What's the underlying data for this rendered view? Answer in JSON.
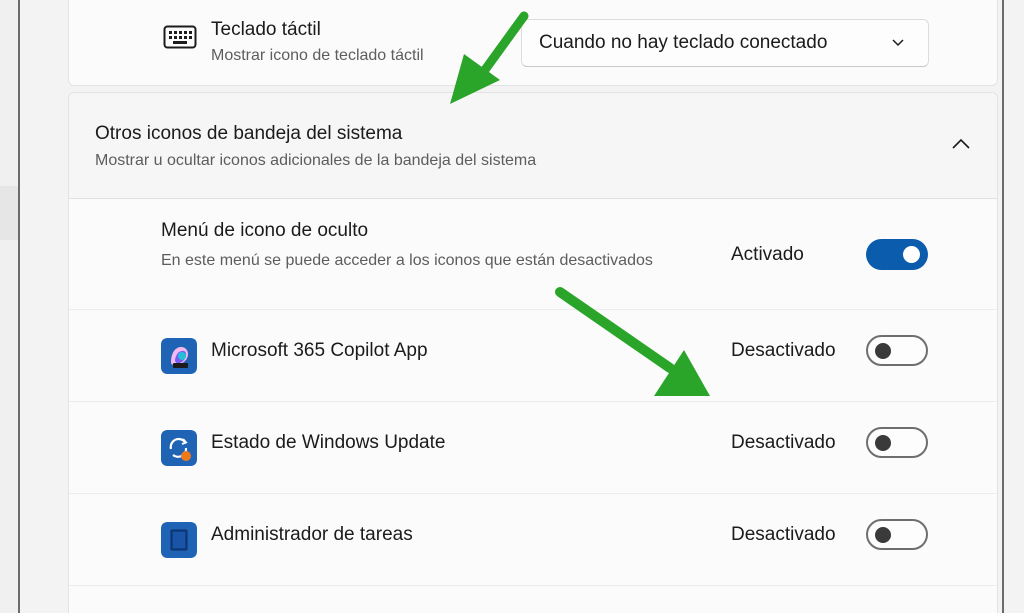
{
  "keyboard_row": {
    "title": "Teclado táctil",
    "subtitle": "Mostrar icono de teclado táctil",
    "icon": "keyboard-icon",
    "dropdown_value": "Cuando no hay teclado conectado"
  },
  "tray_group": {
    "title": "Otros iconos de bandeja del sistema",
    "subtitle": "Mostrar u ocultar iconos adicionales de la bandeja del sistema",
    "expanded": true
  },
  "hidden_menu": {
    "title": "Menú de icono de oculto",
    "subtitle": "En este menú se puede acceder a los iconos que están desactivados",
    "state": "Activado",
    "on": true
  },
  "apps": [
    {
      "name": "Microsoft 365 Copilot App",
      "state": "Desactivado",
      "on": false,
      "icon": "m365-copilot-icon"
    },
    {
      "name": "Estado de Windows Update",
      "state": "Desactivado",
      "on": false,
      "icon": "windows-update-icon"
    },
    {
      "name": "Administrador de tareas",
      "state": "Desactivado",
      "on": false,
      "icon": "task-manager-icon"
    }
  ],
  "colors": {
    "accent": "#0b5cad",
    "annotation_arrow": "#2aa52a"
  }
}
